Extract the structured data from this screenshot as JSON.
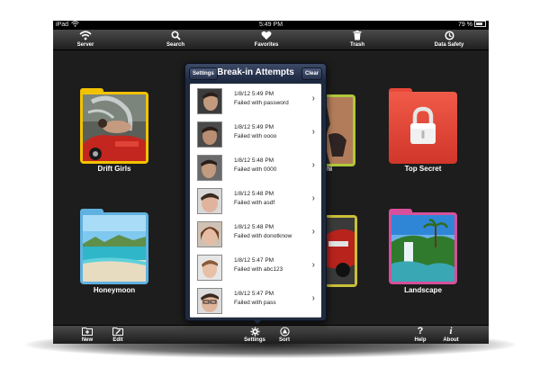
{
  "status_bar": {
    "carrier": "iPad",
    "time": "5:49 PM",
    "battery": "79 %"
  },
  "top_toolbar": {
    "items": [
      {
        "label": "Server",
        "icon": "wifi-icon"
      },
      {
        "label": "Search",
        "icon": "search-icon"
      },
      {
        "label": "Favorites",
        "icon": "heart-icon"
      },
      {
        "label": "Trash",
        "icon": "trash-icon"
      },
      {
        "label": "Data Safety",
        "icon": "history-icon"
      }
    ]
  },
  "folders": [
    {
      "label": "Drift Girls",
      "color": "#f2c200"
    },
    {
      "label": "Top Secret",
      "color": "#e8483a"
    },
    {
      "label": "Honeymoon",
      "color": "#5fb2e0"
    },
    {
      "label": "Landscape",
      "color": "#d84f9c"
    }
  ],
  "partial_folders": [
    {
      "label": "ni",
      "color": "#b0c93a"
    },
    {
      "label": "",
      "color": "#c9c038"
    }
  ],
  "popover": {
    "title": "Break-in Attempts",
    "left_button": "Settings",
    "right_button": "Clear",
    "attempts": [
      {
        "date": "1/8/12 5:49 PM",
        "reason": "Failed with password"
      },
      {
        "date": "1/8/12 5:49 PM",
        "reason": "Failed with oooo"
      },
      {
        "date": "1/8/12 5:48 PM",
        "reason": "Failed with 0000"
      },
      {
        "date": "1/8/12 5:48 PM",
        "reason": "Failed with asdf"
      },
      {
        "date": "1/8/12 5:48 PM",
        "reason": "Failed with donotknow"
      },
      {
        "date": "1/8/12 5:47 PM",
        "reason": "Failed with abc123"
      },
      {
        "date": "1/8/12 5:47 PM",
        "reason": "Failed with pass"
      }
    ]
  },
  "bottom_toolbar": {
    "items": [
      {
        "label": "New",
        "icon": "new-folder-icon"
      },
      {
        "label": "Edit",
        "icon": "edit-icon"
      },
      {
        "label": "Settings",
        "icon": "gear-icon"
      },
      {
        "label": "Sort",
        "icon": "sort-icon"
      },
      {
        "label": "Help",
        "icon": "help-icon"
      },
      {
        "label": "About",
        "icon": "info-icon"
      }
    ]
  }
}
